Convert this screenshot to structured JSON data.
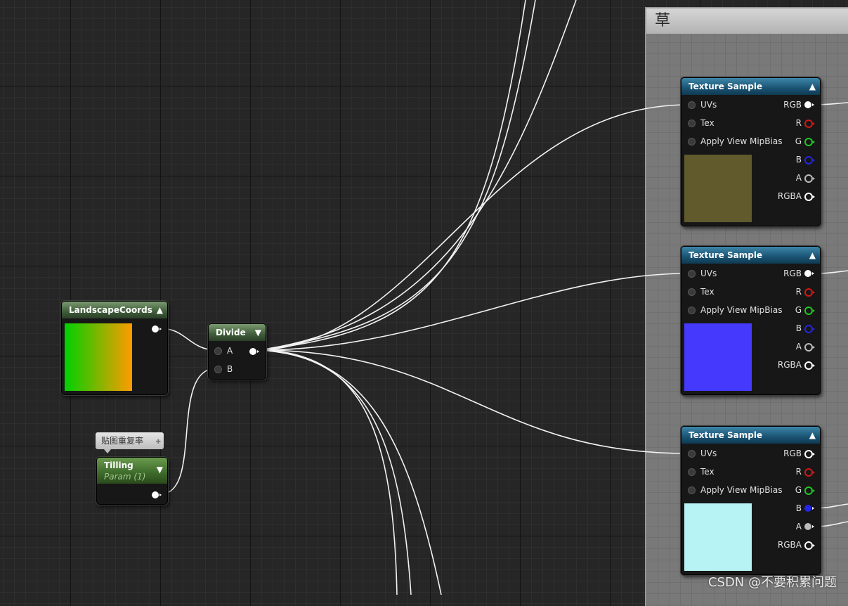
{
  "comment": {
    "title": "草"
  },
  "colors": {
    "swatch_1": "#605a2c",
    "swatch_2": "#4639fe",
    "swatch_3": "#b7f2f5",
    "pin_r": "#d01818",
    "pin_g": "#1ec81e",
    "pin_b": "#2424e8",
    "pin_a": "#bbbbbb"
  },
  "landscape": {
    "title": "LandscapeCoords",
    "collapse_icon": "▲"
  },
  "tilling": {
    "title": "Tilling",
    "subtitle": "Param (1)",
    "collapse_icon": "▼",
    "tooltip": "贴图重复率"
  },
  "divide": {
    "title": "Divide",
    "collapse_icon": "▼",
    "input_a": "A",
    "input_b": "B"
  },
  "texture_nodes": [
    {
      "title": "Texture Sample",
      "collapse_icon": "▲",
      "inputs": [
        "UVs",
        "Tex",
        "Apply View MipBias"
      ],
      "outputs": [
        "RGB",
        "R",
        "G",
        "B",
        "A",
        "RGBA"
      ]
    },
    {
      "title": "Texture Sample",
      "collapse_icon": "▲",
      "inputs": [
        "UVs",
        "Tex",
        "Apply View MipBias"
      ],
      "outputs": [
        "RGB",
        "R",
        "G",
        "B",
        "A",
        "RGBA"
      ]
    },
    {
      "title": "Texture Sample",
      "collapse_icon": "▲",
      "inputs": [
        "UVs",
        "Tex",
        "Apply View MipBias"
      ],
      "outputs": [
        "RGB",
        "R",
        "G",
        "B",
        "A",
        "RGBA"
      ]
    }
  ],
  "watermark": "CSDN @不要积累问题"
}
